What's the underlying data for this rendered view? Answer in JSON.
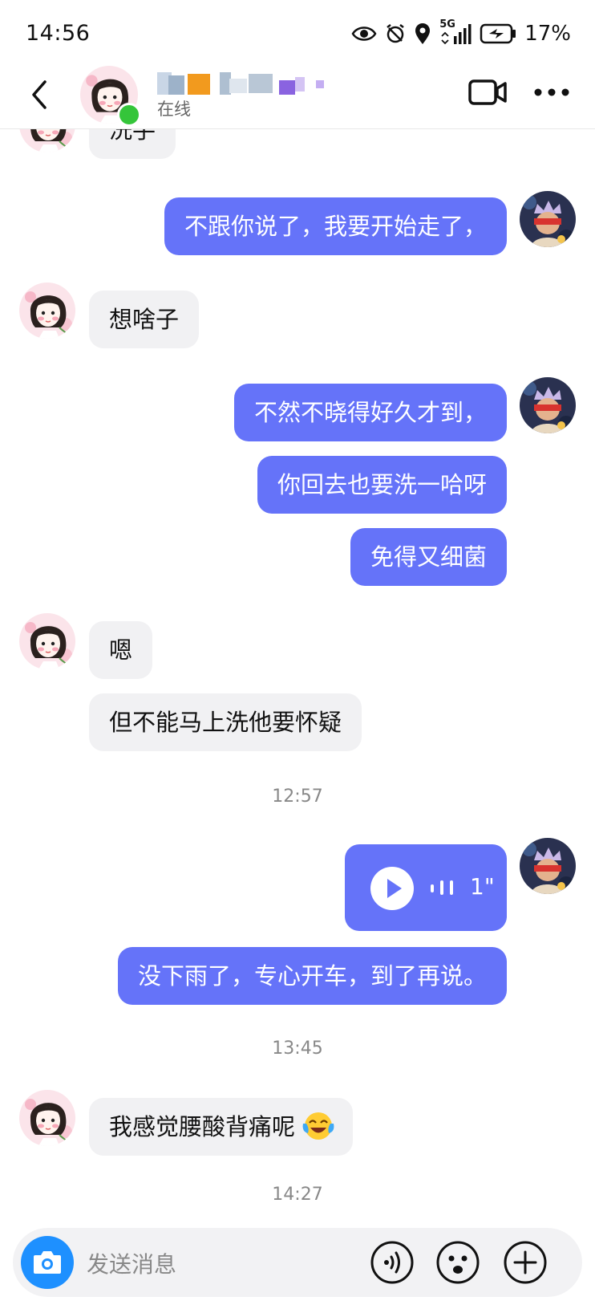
{
  "status_bar": {
    "time": "14:56",
    "network": "5G",
    "battery": "17%"
  },
  "header": {
    "contact_name": "",
    "status": "在线"
  },
  "messages": [
    {
      "side": "in",
      "text": "洗手"
    },
    {
      "side": "out",
      "text": "不跟你说了，我要开始走了，"
    },
    {
      "side": "in",
      "text": "想啥子"
    },
    {
      "side": "out",
      "text": "不然不晓得好久才到，"
    },
    {
      "side": "out",
      "text": "你回去也要洗一哈呀"
    },
    {
      "side": "out",
      "text": "免得又细菌"
    },
    {
      "side": "in",
      "text": "嗯"
    },
    {
      "side": "in",
      "text": "但不能马上洗他要怀疑"
    },
    {
      "side": "out",
      "type": "voice",
      "duration": "1\""
    },
    {
      "side": "out",
      "text": "没下雨了，专心开车，到了再说。"
    },
    {
      "side": "in",
      "text": "我感觉腰酸背痛呢"
    }
  ],
  "timestamps": [
    "12:57",
    "13:45",
    "14:27"
  ],
  "input": {
    "placeholder": "发送消息"
  },
  "colors": {
    "outgoing_bubble": "#6573f9",
    "incoming_bubble": "#f1f1f3",
    "online": "#35c53a",
    "camera": "#1e90ff"
  },
  "icons": [
    "back-icon",
    "video-call-icon",
    "more-icon",
    "camera-icon",
    "voice-input-icon",
    "emoji-icon",
    "plus-icon",
    "play-icon",
    "tears-of-joy-emoji"
  ]
}
